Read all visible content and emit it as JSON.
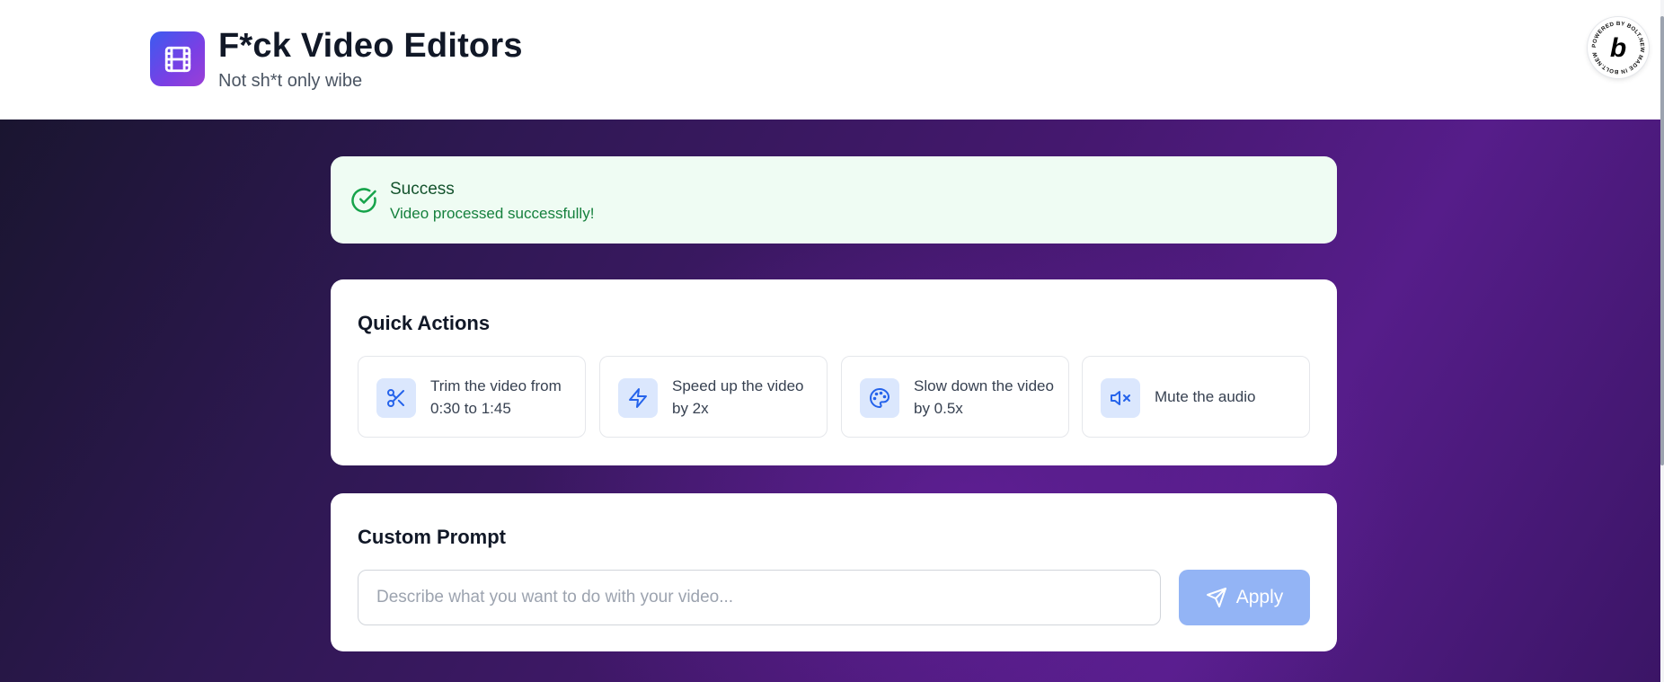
{
  "app": {
    "title": "F*ck Video Editors",
    "subtitle": "Not sh*t only wibe",
    "logo_icon": "film-icon",
    "badge_icon": "bolt-b-icon",
    "badge_ring_text": "POWERED BY BOLT.NEW MADE IN BOLT.NEW"
  },
  "alert": {
    "title": "Success",
    "message": "Video processed successfully!",
    "icon": "check-circle-icon",
    "color": "#16a34a"
  },
  "quick_actions": {
    "title": "Quick Actions",
    "items": [
      {
        "label": "Trim the video from 0:30 to 1:45",
        "icon": "scissors-icon"
      },
      {
        "label": "Speed up the video by 2x",
        "icon": "lightning-icon"
      },
      {
        "label": "Slow down the video by 0.5x",
        "icon": "palette-icon"
      },
      {
        "label": "Mute the audio",
        "icon": "volume-mute-icon"
      }
    ]
  },
  "custom_prompt": {
    "title": "Custom Prompt",
    "placeholder": "Describe what you want to do with your video...",
    "value": "",
    "button_label": "Apply",
    "button_icon": "send-icon"
  },
  "colors": {
    "accent": "#2563eb",
    "accent_soft": "#dbe7fd",
    "button_disabled": "#93b4f5",
    "success_bg": "#effcf3",
    "background_purple": "#561d8a"
  }
}
